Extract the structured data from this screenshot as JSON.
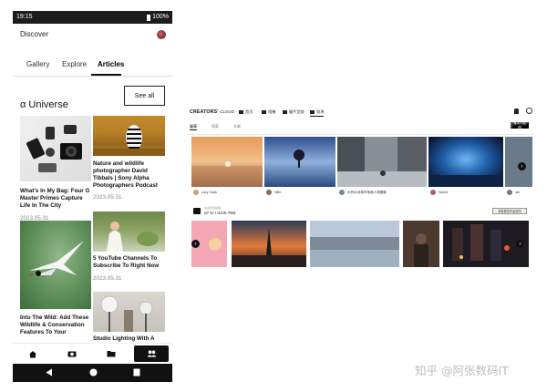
{
  "phone": {
    "status": {
      "time": "19:15",
      "battery": "100%"
    },
    "header": {
      "title": "Discover"
    },
    "tabs": [
      {
        "label": "Gallery"
      },
      {
        "label": "Explore"
      },
      {
        "label": "Articles"
      }
    ],
    "section": {
      "title": "α Universe",
      "see_all": "See all"
    },
    "articles": [
      {
        "title": "What's In My Bag: Four G Master Primes Capture Life In The City",
        "date": "2023.05.31"
      },
      {
        "title": "Nature and wildlife photographer David Tibbals | Sony Alpha Photographers Podcast",
        "date": "2023.05.31"
      },
      {
        "title": "Into The Wild: Add These Wildlife & Conservation Features To Your",
        "date": ""
      },
      {
        "title": "5 YouTube Channels To Subscribe To Right Now",
        "date": "2023.05.31"
      },
      {
        "title": "Studio Lighting With A",
        "date": ""
      }
    ],
    "bottom_nav": [
      {
        "icon": "home-icon"
      },
      {
        "icon": "camera-icon"
      },
      {
        "icon": "folder-icon"
      },
      {
        "icon": "people-icon",
        "active": true
      }
    ]
  },
  "desktop": {
    "brand": "CREATORS'",
    "brand_sub": "CLOUD",
    "nav": [
      {
        "label": "首页",
        "icon": "home-icon"
      },
      {
        "label": "相機",
        "icon": "camera-icon"
      },
      {
        "label": "圖片型錄",
        "icon": "folder-icon"
      },
      {
        "label": "發現",
        "icon": "people-icon",
        "active": true
      }
    ],
    "subtabs": [
      "圖庫",
      "探索",
      "文章"
    ],
    "login": "登入 / 註冊",
    "featured_authors": [
      {
        "name": "Lucy Yada"
      },
      {
        "name": "Nifie"
      },
      {
        "name": "木質水泥城市地面人物攝影"
      },
      {
        "name": "Sacrid"
      },
      {
        "name": "ran"
      }
    ],
    "camera_section": {
      "subtitle": "在此裝置拍攝",
      "title": "α7 IV / ILCE-7M4",
      "more": "查看更多作品資訊"
    }
  },
  "watermark": "知乎 @阿张数码IT"
}
